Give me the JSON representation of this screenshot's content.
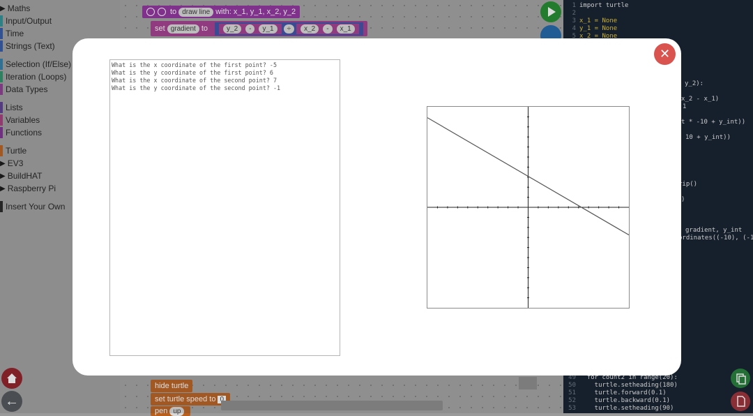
{
  "sidebar": {
    "categories": [
      {
        "label": "Maths",
        "color": "#2f56a6",
        "expandable": true
      },
      {
        "label": "Input/Output",
        "color": "#2b8f94",
        "expandable": false
      },
      {
        "label": "Time",
        "color": "#2f56a6",
        "expandable": false
      },
      {
        "label": "Strings (Text)",
        "color": "#2f56a6",
        "expandable": false
      },
      {
        "label": "Selection (If/Else)",
        "color": "#2f7aa6",
        "expandable": false
      },
      {
        "label": "Iteration (Loops)",
        "color": "#2b8f6a",
        "expandable": false
      },
      {
        "label": "Data Types",
        "color": "#8a3b8e",
        "expandable": false
      },
      {
        "label": "Lists",
        "color": "#5a3b8e",
        "expandable": false
      },
      {
        "label": "Variables",
        "color": "#a33b7a",
        "expandable": false
      },
      {
        "label": "Functions",
        "color": "#7a2f8e",
        "expandable": false
      },
      {
        "label": "Turtle",
        "color": "#b85f1e",
        "expandable": false
      },
      {
        "label": "EV3",
        "color": "#5a8a1e",
        "expandable": true
      },
      {
        "label": "BuildHAT",
        "color": "#8a8a1e",
        "expandable": true
      },
      {
        "label": "Raspberry Pi",
        "color": "#8e1e3b",
        "expandable": true
      },
      {
        "label": "Insert Your Own",
        "color": "#222222",
        "expandable": false
      }
    ]
  },
  "workspace": {
    "func_header": {
      "to": "to",
      "name": "draw line",
      "with": "with: x_1, y_1, x_2, y_2"
    },
    "set_block": {
      "set": "set",
      "var": "gradient",
      "to": "to",
      "a": "y_2",
      "op1": "-",
      "b": "y_1",
      "div": "÷",
      "c": "x_2",
      "op2": "-",
      "d": "x_1"
    },
    "hide_turtle": "hide turtle",
    "speed_block": {
      "label": "set turtle speed to",
      "value": "0"
    },
    "pen_block": {
      "label": "pen",
      "value": "up"
    }
  },
  "code": {
    "top": [
      {
        "n": "1",
        "t": "import turtle"
      },
      {
        "n": "2",
        "t": ""
      },
      {
        "n": "3",
        "t": "x_1 = None"
      },
      {
        "n": "4",
        "t": "y_1 = None"
      },
      {
        "n": "5",
        "t": "x_2 = None"
      }
    ],
    "fragments": [
      {
        "t": "y_2):"
      },
      {
        "t": "x_2 - x_1)"
      },
      {
        "t": "1"
      },
      {
        "t": "t * -10 + y_int))"
      },
      {
        "t": "10 + y_int))"
      },
      {
        "t": "rip()"
      },
      {
        "t": ")"
      },
      {
        "t": "gradient, y_int"
      },
      {
        "t": "ordinates((-10), (-1"
      }
    ],
    "bottom": [
      {
        "n": "49",
        "t": "  for count2 in range(20):"
      },
      {
        "n": "50",
        "t": "    turtle.setheading(180)"
      },
      {
        "n": "51",
        "t": "    turtle.forward(0.1)"
      },
      {
        "n": "52",
        "t": "    turtle.backward(0.1)"
      },
      {
        "n": "53",
        "t": "    turtle.setheading(90)"
      }
    ]
  },
  "modal": {
    "close_label": "✕",
    "console_lines": [
      "What is the x coordinate of the first point? -5",
      "What is the y coordinate of the first point? 6",
      "What is the x coordinate of the second point? 7",
      "What is the y coordinate of the second point? -1"
    ],
    "plot": {
      "x_range": [
        -10,
        10
      ],
      "y_range": [
        -10,
        10
      ],
      "ticks_every": 1,
      "line": {
        "x1": -5,
        "y1": 6,
        "x2": 7,
        "y2": -1
      },
      "line_color": "#555555"
    }
  },
  "buttons": {
    "back_label": "←"
  }
}
